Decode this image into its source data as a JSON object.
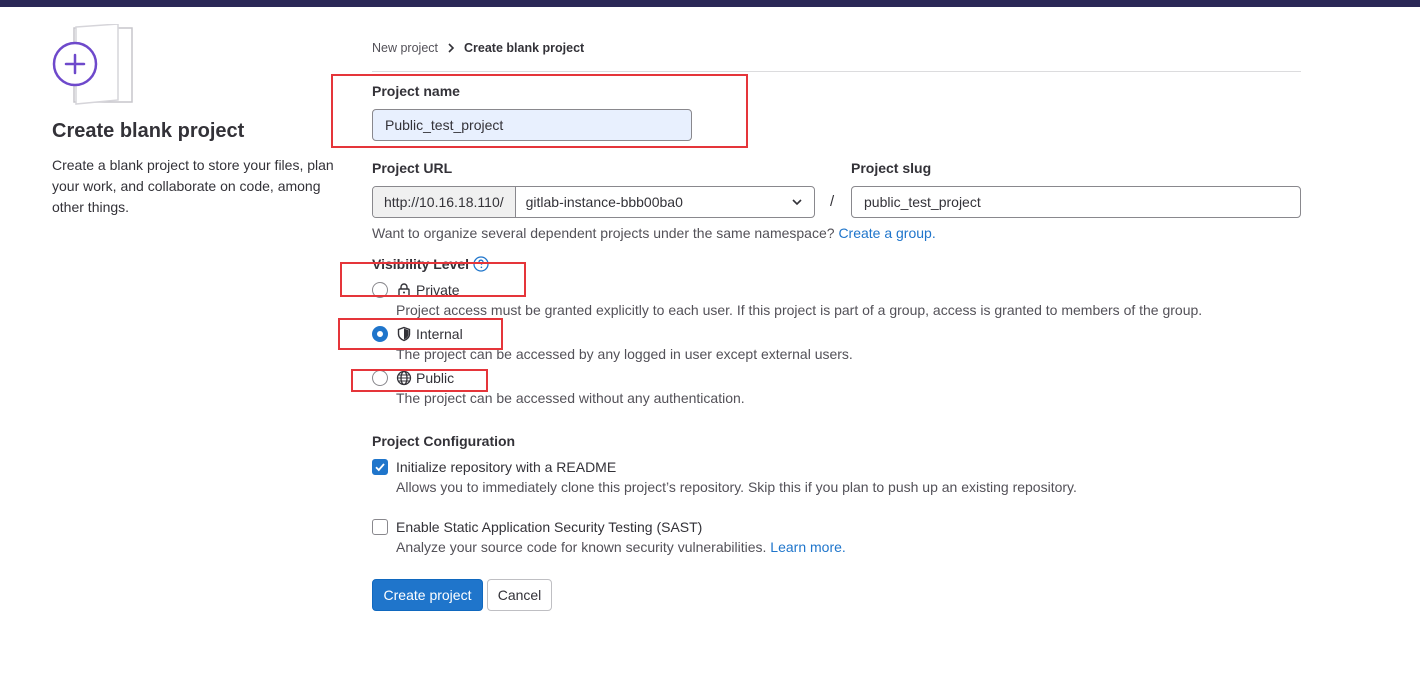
{
  "colors": {
    "top_bar": "#2a2857",
    "accent": "#1f75cb",
    "annotation": "#e5353a",
    "illustration": "#6e49cb"
  },
  "left_panel": {
    "icon": "plus-circle-icon",
    "title": "Create blank project",
    "description": "Create a blank project to store your files, plan your work, and collaborate on code, among other things."
  },
  "breadcrumb": {
    "items": [
      "New project",
      "Create blank project"
    ],
    "separator_icon": "chevron-right-icon"
  },
  "form": {
    "project_name": {
      "label": "Project name",
      "value": "Public_test_project"
    },
    "project_url": {
      "label": "Project URL",
      "prefix": "http://10.16.18.110/",
      "namespace": "gitlab-instance-bbb00ba0",
      "separator": "/"
    },
    "project_slug": {
      "label": "Project slug",
      "value": "public_test_project"
    },
    "namespace_help": {
      "text": "Want to organize several dependent projects under the same namespace?",
      "link": "Create a group."
    },
    "visibility": {
      "label": "Visibility Level",
      "help_icon": "question-circle-icon",
      "selected": "Internal",
      "options": [
        {
          "label": "Private",
          "icon": "lock-icon",
          "description": "Project access must be granted explicitly to each user. If this project is part of a group, access is granted to members of the group."
        },
        {
          "label": "Internal",
          "icon": "shield-icon",
          "description": "The project can be accessed by any logged in user except external users."
        },
        {
          "label": "Public",
          "icon": "globe-icon",
          "description": "The project can be accessed without any authentication."
        }
      ]
    },
    "configuration": {
      "label": "Project Configuration",
      "readme": {
        "label": "Initialize repository with a README",
        "checked": true,
        "description": "Allows you to immediately clone this project’s repository. Skip this if you plan to push up an existing repository."
      },
      "sast": {
        "label": "Enable Static Application Security Testing (SAST)",
        "checked": false,
        "description": "Analyze your source code for known security vulnerabilities.",
        "link": "Learn more."
      }
    },
    "buttons": {
      "create": "Create project",
      "cancel": "Cancel"
    }
  }
}
